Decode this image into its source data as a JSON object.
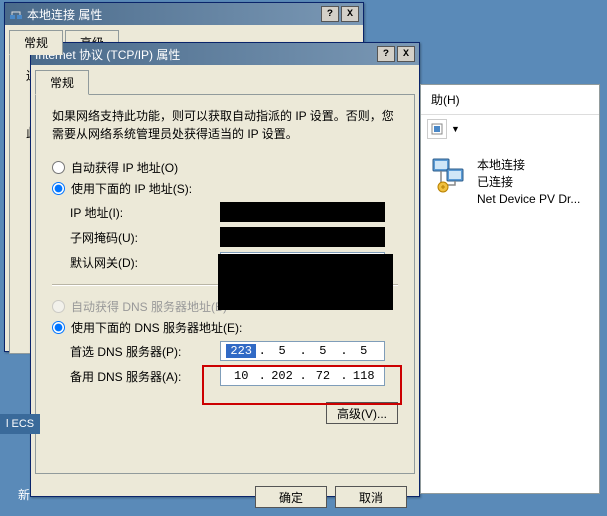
{
  "parentWindow": {
    "title": "本地连接 属性",
    "tabs": {
      "general": "常规",
      "advanced": "高级"
    },
    "partial_text": "连接时使用:",
    "this_text": "此"
  },
  "tcpipWindow": {
    "title": "Internet 协议 (TCP/IP) 属性",
    "tab_general": "常规",
    "description": "如果网络支持此功能，则可以获取自动指派的 IP 设置。否则，您需要从网络系统管理员处获得适当的 IP 设置。",
    "radio_auto_ip": "自动获得 IP 地址(O)",
    "radio_manual_ip": "使用下面的 IP 地址(S):",
    "label_ip": "IP 地址(I):",
    "label_mask": "子网掩码(U):",
    "label_gw": "默认网关(D):",
    "radio_auto_dns": "自动获得 DNS 服务器地址(B)",
    "radio_manual_dns": "使用下面的 DNS 服务器地址(E):",
    "label_dns1": "首选 DNS 服务器(P):",
    "label_dns2": "备用 DNS 服务器(A):",
    "dns1": {
      "a": "223",
      "b": "5",
      "c": "5",
      "d": "5"
    },
    "dns2": {
      "a": "10",
      "b": "202",
      "c": "72",
      "d": "118"
    },
    "gw": {
      "a": "",
      "b": "",
      "c": "",
      "d": ""
    },
    "btn_adv": "高级(V)...",
    "btn_ok": "确定",
    "btn_cancel": "取消"
  },
  "rightPanel": {
    "help_label": "助(H)",
    "conn_name": "本地连接",
    "conn_status": "已连接",
    "conn_device": "Net Device PV Dr..."
  },
  "fragments": {
    "ecs": "l ECS",
    "xin": "新"
  },
  "titlebar_btns": {
    "help": "?",
    "close": "X"
  }
}
